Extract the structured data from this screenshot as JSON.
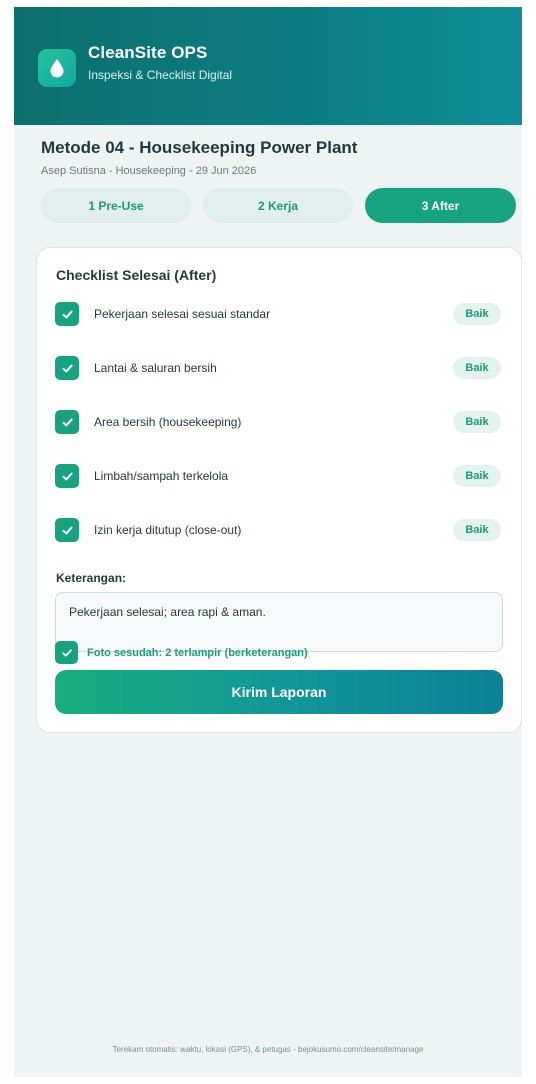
{
  "app": {
    "title": "CleanSite OPS",
    "subtitle": "Inspeksi & Checklist Digital",
    "logo_icon": "water-drop-icon"
  },
  "method": {
    "title": "Metode 04 - Housekeeping Power Plant",
    "meta": "Asep Sutisna - Housekeeping - 29 Jun 2026"
  },
  "steps": [
    {
      "label": "1  Pre-Use",
      "active": false
    },
    {
      "label": "2  Kerja",
      "active": false
    },
    {
      "label": "3  After",
      "active": true
    }
  ],
  "checklist": {
    "title": "Checklist Selesai (After)",
    "items": [
      {
        "label": "Pekerjaan selesai sesuai standar",
        "checked": true,
        "status": "Baik"
      },
      {
        "label": "Lantai & saluran bersih",
        "checked": true,
        "status": "Baik"
      },
      {
        "label": "Area bersih (housekeeping)",
        "checked": true,
        "status": "Baik"
      },
      {
        "label": "Limbah/sampah terkelola",
        "checked": true,
        "status": "Baik"
      },
      {
        "label": "Izin kerja ditutup (close-out)",
        "checked": true,
        "status": "Baik"
      }
    ]
  },
  "notes": {
    "label": "Keterangan:",
    "value": "Pekerjaan selesai; area rapi & aman."
  },
  "photo": {
    "checked": true,
    "label": "Foto sesudah: 2 terlampir (berketerangan)"
  },
  "submit_label": "Kirim Laporan",
  "footer": "Terekam otomatis: waktu, lokasi (GPS), & petugas - bejokusumo.com/cleansite/manage",
  "colors": {
    "header_start": "#0d6f6d",
    "header_end": "#0e8e98",
    "accent": "#16a37f",
    "background": "#eef3f4"
  }
}
